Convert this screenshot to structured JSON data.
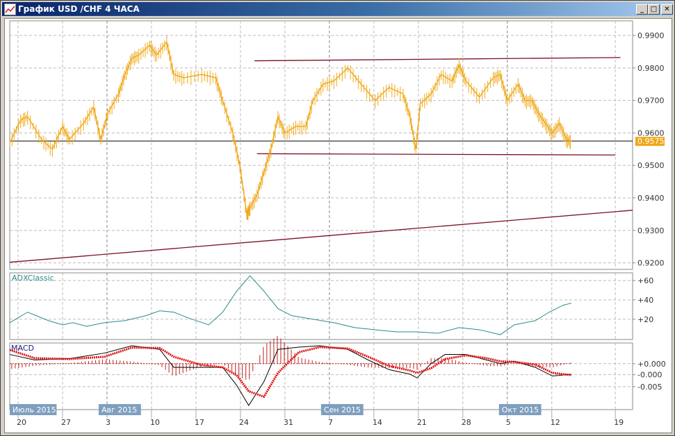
{
  "window": {
    "title": "График USD /CHF  4 ЧАСА",
    "minimize": "_",
    "maximize": "□",
    "close": "✕"
  },
  "colors": {
    "price": "#f0a818",
    "trend": "#7a1020",
    "adx": "#2a8a8a",
    "macd": "#000000",
    "signal": "#e01010",
    "badge": "#7f9fbf"
  },
  "chart_data": [
    {
      "type": "line",
      "name": "price",
      "ylim": [
        0.918,
        0.9945
      ],
      "yticks": [
        "0.9900",
        "0.9800",
        "0.9700",
        "0.9600",
        "0.9500",
        "0.9400",
        "0.9300",
        "0.9200"
      ],
      "ytick_values": [
        0.99,
        0.98,
        0.97,
        0.96,
        0.95,
        0.94,
        0.93,
        0.92
      ],
      "current_label": "0.9575",
      "current_value": 0.9575,
      "series": [
        [
          -1.3,
          0.957
        ],
        [
          0.4,
          0.964
        ],
        [
          1.5,
          0.965
        ],
        [
          3.7,
          0.958
        ],
        [
          5.4,
          0.955
        ],
        [
          7,
          0.962
        ],
        [
          8.1,
          0.958
        ],
        [
          10.3,
          0.963
        ],
        [
          11.9,
          0.968
        ],
        [
          13,
          0.958
        ],
        [
          14.1,
          0.966
        ],
        [
          15.8,
          0.972
        ],
        [
          16.8,
          0.978
        ],
        [
          17.9,
          0.983
        ],
        [
          19,
          0.984
        ],
        [
          20.7,
          0.987
        ],
        [
          21.8,
          0.984
        ],
        [
          23.4,
          0.988
        ],
        [
          24.5,
          0.978
        ],
        [
          26.1,
          0.977
        ],
        [
          28.9,
          0.978
        ],
        [
          31.1,
          0.977
        ],
        [
          32.2,
          0.97
        ],
        [
          33.8,
          0.96
        ],
        [
          34.9,
          0.95
        ],
        [
          36,
          0.935
        ],
        [
          36.5,
          0.937
        ],
        [
          37.6,
          0.941
        ],
        [
          38.7,
          0.948
        ],
        [
          39.8,
          0.955
        ],
        [
          40.9,
          0.965
        ],
        [
          42,
          0.96
        ],
        [
          43.7,
          0.962
        ],
        [
          45.3,
          0.962
        ],
        [
          46.4,
          0.97
        ],
        [
          48,
          0.975
        ],
        [
          49.7,
          0.976
        ],
        [
          51.9,
          0.98
        ],
        [
          54,
          0.975
        ],
        [
          56.2,
          0.97
        ],
        [
          58.4,
          0.974
        ],
        [
          60.6,
          0.972
        ],
        [
          61.7,
          0.965
        ],
        [
          62.6,
          0.955
        ],
        [
          63.3,
          0.969
        ],
        [
          65,
          0.972
        ],
        [
          66.6,
          0.978
        ],
        [
          68.3,
          0.976
        ],
        [
          69.4,
          0.981
        ],
        [
          70.5,
          0.976
        ],
        [
          72.6,
          0.971
        ],
        [
          74.8,
          0.977
        ],
        [
          75.9,
          0.978
        ],
        [
          77,
          0.97
        ],
        [
          78.7,
          0.975
        ],
        [
          79.8,
          0.97
        ],
        [
          80.9,
          0.97
        ],
        [
          81.9,
          0.966
        ],
        [
          83,
          0.963
        ],
        [
          84.1,
          0.96
        ],
        [
          85.2,
          0.963
        ],
        [
          86.3,
          0.958
        ],
        [
          87.1,
          0.9575
        ]
      ],
      "trendlines": [
        {
          "from": [
            37.2,
            0.9822
          ],
          "to": [
            94.8,
            0.9832
          ]
        },
        {
          "from": [
            37.6,
            0.9536
          ],
          "to": [
            94,
            0.9532
          ]
        },
        {
          "from": [
            -1.3,
            0.9202
          ],
          "to": [
            96.7,
            0.9362
          ]
        }
      ]
    },
    {
      "type": "line",
      "name": "ADXClassic",
      "title": "ADXClassic",
      "ylim": [
        -1,
        68
      ],
      "yticks": [
        "+60",
        "+40",
        "+20"
      ],
      "ytick_values": [
        60,
        40,
        20
      ],
      "series": [
        [
          -1.3,
          16.4
        ],
        [
          1.5,
          27.3
        ],
        [
          4.8,
          18.5
        ],
        [
          7,
          14.2
        ],
        [
          8.6,
          16.4
        ],
        [
          10.8,
          12.7
        ],
        [
          13.6,
          16.4
        ],
        [
          16.8,
          18.5
        ],
        [
          20.1,
          23.6
        ],
        [
          22.3,
          28.7
        ],
        [
          24.5,
          27.3
        ],
        [
          26.7,
          21.5
        ],
        [
          30,
          14.2
        ],
        [
          32.2,
          27.3
        ],
        [
          34.4,
          49
        ],
        [
          36.5,
          65
        ],
        [
          38.7,
          49
        ],
        [
          40.9,
          31
        ],
        [
          43.1,
          23.6
        ],
        [
          46.4,
          20
        ],
        [
          49.7,
          16.4
        ],
        [
          53,
          11.3
        ],
        [
          56.2,
          9.1
        ],
        [
          59.5,
          6.9
        ],
        [
          62.8,
          6.9
        ],
        [
          66.1,
          5.5
        ],
        [
          69.4,
          11.3
        ],
        [
          72.6,
          9.1
        ],
        [
          75.9,
          4
        ],
        [
          78.1,
          14.2
        ],
        [
          81.4,
          18.5
        ],
        [
          83.6,
          27.3
        ],
        [
          85.8,
          34.5
        ],
        [
          87.1,
          36.7
        ]
      ]
    },
    {
      "type": "line",
      "name": "MACD",
      "title": "MACD",
      "ylim": [
        -0.01,
        0.0045
      ],
      "yticks": [
        "+0.000",
        "-0.000",
        "-0.005"
      ],
      "ytick_values": [
        0.0,
        -0.0024,
        -0.005
      ],
      "macd": [
        [
          -1.3,
          0.002
        ],
        [
          2.6,
          0.0008
        ],
        [
          8.1,
          0.0011
        ],
        [
          13.6,
          0.0023
        ],
        [
          17.9,
          0.0039
        ],
        [
          22.3,
          0.0031
        ],
        [
          24.5,
          -0.0008
        ],
        [
          28.9,
          -0.0008
        ],
        [
          32.2,
          -0.0008
        ],
        [
          34.4,
          -0.0047
        ],
        [
          36.3,
          -0.0091
        ],
        [
          38.7,
          -0.0039
        ],
        [
          40.9,
          0.0031
        ],
        [
          44.2,
          0.0036
        ],
        [
          47.5,
          0.0039
        ],
        [
          51.9,
          0.0031
        ],
        [
          55.1,
          0.0008
        ],
        [
          58.4,
          -0.0013
        ],
        [
          61.7,
          -0.0023
        ],
        [
          62.8,
          -0.0031
        ],
        [
          65,
          0.0
        ],
        [
          67.2,
          0.002
        ],
        [
          70.5,
          0.002
        ],
        [
          73.7,
          0.0008
        ],
        [
          75.9,
          0.0
        ],
        [
          78.1,
          0.0005
        ],
        [
          81.4,
          -0.0008
        ],
        [
          84.1,
          -0.0027
        ],
        [
          87.1,
          -0.0023
        ]
      ],
      "signal": [
        [
          -1.3,
          0.003
        ],
        [
          2.6,
          0.0012
        ],
        [
          8.1,
          0.001
        ],
        [
          13.6,
          0.0015
        ],
        [
          17.9,
          0.0035
        ],
        [
          22.3,
          0.0034
        ],
        [
          24.5,
          0.0015
        ],
        [
          28.9,
          -0.0003
        ],
        [
          32.2,
          -0.0008
        ],
        [
          34.4,
          -0.0025
        ],
        [
          36.3,
          -0.006
        ],
        [
          38.7,
          -0.0072
        ],
        [
          40.9,
          -0.002
        ],
        [
          44.2,
          0.0025
        ],
        [
          47.5,
          0.0036
        ],
        [
          51.9,
          0.0033
        ],
        [
          55.1,
          0.0015
        ],
        [
          58.4,
          -0.0005
        ],
        [
          61.7,
          -0.0015
        ],
        [
          62.8,
          -0.002
        ],
        [
          65,
          -0.001
        ],
        [
          67.2,
          0.001
        ],
        [
          70.5,
          0.0018
        ],
        [
          73.7,
          0.0012
        ],
        [
          75.9,
          0.0005
        ],
        [
          78.1,
          0.0004
        ],
        [
          81.4,
          -0.0002
        ],
        [
          84.1,
          -0.002
        ],
        [
          87.1,
          -0.0025
        ]
      ]
    }
  ],
  "xaxis": {
    "ticks": [
      {
        "day": 0,
        "label": "20"
      },
      {
        "day": 7,
        "label": "27"
      },
      {
        "day": 14,
        "label": "3"
      },
      {
        "day": 21,
        "label": "10"
      },
      {
        "day": 28,
        "label": "17"
      },
      {
        "day": 35,
        "label": "24"
      },
      {
        "day": 42,
        "label": "31"
      },
      {
        "day": 49,
        "label": "7"
      },
      {
        "day": 56,
        "label": "14"
      },
      {
        "day": 63,
        "label": "21"
      },
      {
        "day": 70,
        "label": "28"
      },
      {
        "day": 77,
        "label": "5"
      },
      {
        "day": 84,
        "label": "12"
      },
      {
        "day": 94,
        "label": "19"
      }
    ],
    "months": [
      {
        "day": 0,
        "label": "Июль 2015"
      },
      {
        "day": 14,
        "label": "Авг 2015"
      },
      {
        "day": 49,
        "label": "Сен 2015"
      },
      {
        "day": 77,
        "label": "Окт 2015"
      }
    ]
  }
}
